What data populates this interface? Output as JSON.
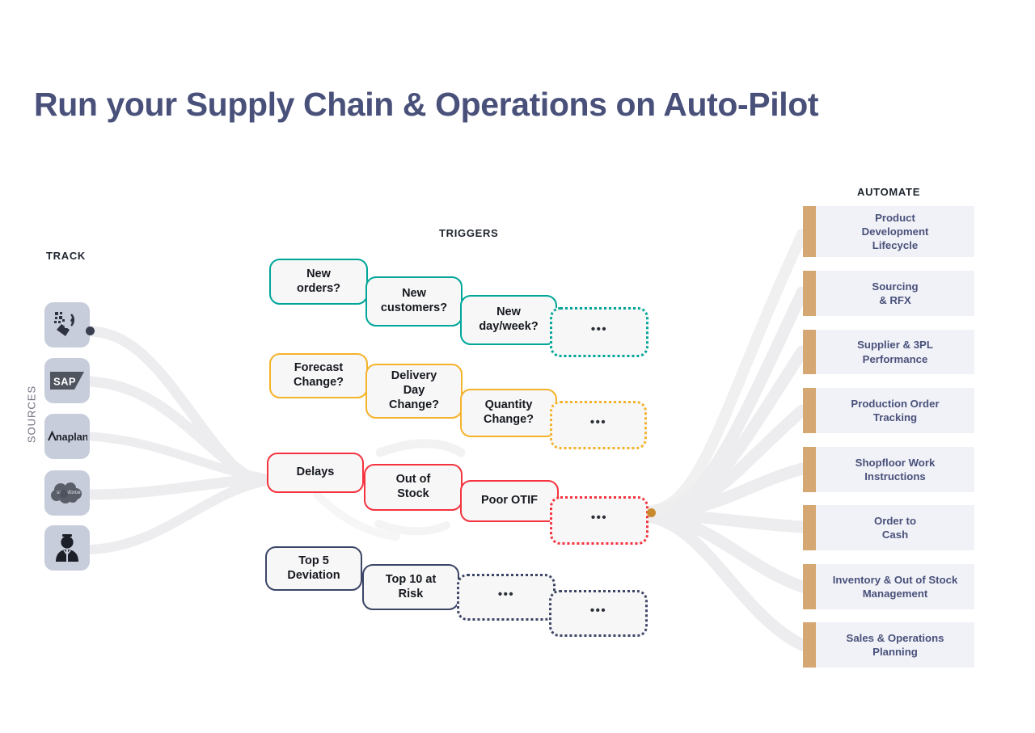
{
  "page": {
    "title": "Run your Supply Chain & Operations on Auto-Pilot",
    "accent_title_color": "#49517a",
    "background": "#ffffff"
  },
  "columns": {
    "track_header": "TRACK",
    "triggers_header": "TRIGGERS",
    "automate_header": "AUTOMATE",
    "sources_label": "SOURCES"
  },
  "sources": {
    "items": [
      {
        "name": "scan-qr-icon",
        "label": "Barcode / QR Scan"
      },
      {
        "name": "sap-logo-icon",
        "label": "SAP"
      },
      {
        "name": "anaplan-logo-icon",
        "label": "Anaplan"
      },
      {
        "name": "salesforce-logo-icon",
        "label": "salesforce"
      },
      {
        "name": "user-person-icon",
        "label": "User"
      }
    ]
  },
  "triggers": {
    "ellipsis": "•••",
    "rows": [
      {
        "color": "#00a699",
        "boxes": [
          {
            "label": "New\norders?",
            "dotted": false
          },
          {
            "label": "New\ncustomers?",
            "dotted": false
          },
          {
            "label": "New\nday/week?",
            "dotted": false
          },
          {
            "label": "•••",
            "dotted": true
          }
        ]
      },
      {
        "color": "#f5b32b",
        "boxes": [
          {
            "label": "Forecast\nChange?",
            "dotted": false
          },
          {
            "label": "Delivery\nDay\nChange?",
            "dotted": false
          },
          {
            "label": "Quantity\nChange?",
            "dotted": false
          },
          {
            "label": "•••",
            "dotted": true
          }
        ]
      },
      {
        "color": "#f5333f",
        "boxes": [
          {
            "label": "Delays",
            "dotted": false
          },
          {
            "label": "Out of\nStock",
            "dotted": false
          },
          {
            "label": "Poor OTIF",
            "dotted": false
          },
          {
            "label": "•••",
            "dotted": true
          }
        ]
      },
      {
        "color": "#3c4566",
        "boxes": [
          {
            "label": "Top 5\nDeviation",
            "dotted": false
          },
          {
            "label": "Top 10 at\nRisk",
            "dotted": false
          },
          {
            "label": "•••",
            "dotted": true
          },
          {
            "label": "•••",
            "dotted": true
          }
        ]
      }
    ]
  },
  "automate": {
    "bar_color": "#d5a873",
    "card_bg": "#f1f2f8",
    "text_color": "#49517a",
    "cards": [
      {
        "label": "Product\nDevelopment\nLifecycle"
      },
      {
        "label": "Sourcing\n& RFX"
      },
      {
        "label": "Supplier & 3PL\nPerformance"
      },
      {
        "label": "Production Order\nTracking"
      },
      {
        "label": "Shopfloor Work\nInstructions"
      },
      {
        "label": "Order to\nCash"
      },
      {
        "label": "Inventory & Out of Stock\nManagement"
      },
      {
        "label": "Sales & Operations\nPlanning"
      }
    ]
  },
  "connectors": {
    "ribbon_color": "#ededef",
    "hub_dot_color": "#c98a2e",
    "source_dot_color": "#3a3f50"
  }
}
